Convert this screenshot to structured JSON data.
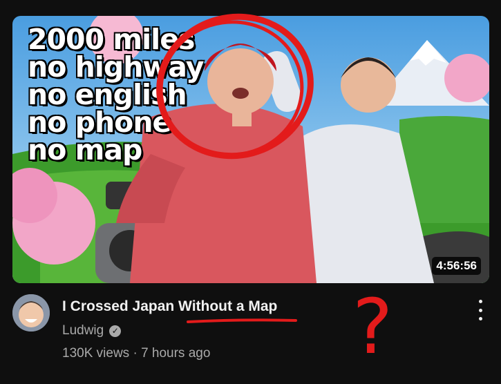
{
  "video": {
    "duration": "4:56:56",
    "overlay_lines": [
      "2000 miles",
      "no highway",
      "no english",
      "no phone",
      "no map"
    ],
    "title": "I Crossed Japan Without a Map",
    "channel": "Ludwig",
    "verified_mark": "✓",
    "views": "130K views",
    "separator": "·",
    "age": "7 hours ago"
  },
  "annotations": {
    "question_mark": "?"
  },
  "icons": {
    "verified": "check-circle-icon",
    "menu": "more-vert-icon"
  },
  "colors": {
    "background": "#0f0f0f",
    "title_text": "#f1f1f1",
    "secondary_text": "#aaaaaa",
    "annotation_red": "#e31b1b"
  }
}
